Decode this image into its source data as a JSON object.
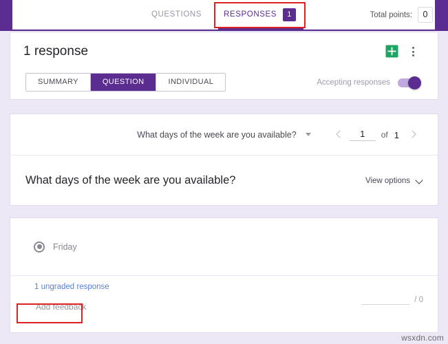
{
  "topbar": {
    "tabs": [
      {
        "label": "QUESTIONS",
        "active": false
      },
      {
        "label": "RESPONSES",
        "active": true,
        "badge": "1"
      }
    ],
    "total_points_label": "Total points:",
    "total_points_value": "0",
    "accent_color": "#5c2d91"
  },
  "summary_card": {
    "response_count": "1 response",
    "sheets_icon": "google-sheets-icon",
    "more_icon": "more-vert-icon",
    "view_modes": [
      {
        "label": "SUMMARY",
        "active": false
      },
      {
        "label": "QUESTION",
        "active": true
      },
      {
        "label": "INDIVIDUAL",
        "active": false
      }
    ],
    "accepting_label": "Accepting responses",
    "accepting_on": true
  },
  "question_card": {
    "selector_text": "What days of the week are you available?",
    "selector_icon": "chevron-down-icon",
    "prev_icon": "chevron-left-icon",
    "next_icon": "chevron-right-icon",
    "page_current": "1",
    "page_of": "of",
    "page_total": "1",
    "question_title": "What days of the week are you available?",
    "view_options_label": "View options",
    "view_options_icon": "chevron-down-icon"
  },
  "answer_card": {
    "answer_text": "Friday",
    "answer_selected": true,
    "ungraded_text": "1 ungraded response",
    "add_feedback_label": "Add feedback",
    "score_value": "",
    "score_max": "/ 0"
  },
  "annotations": {
    "responses_tab_highlight": "red-box-responses-tab",
    "add_feedback_highlight": "red-box-add-feedback",
    "color": "#e02020"
  },
  "watermark": "wsxdn.com"
}
